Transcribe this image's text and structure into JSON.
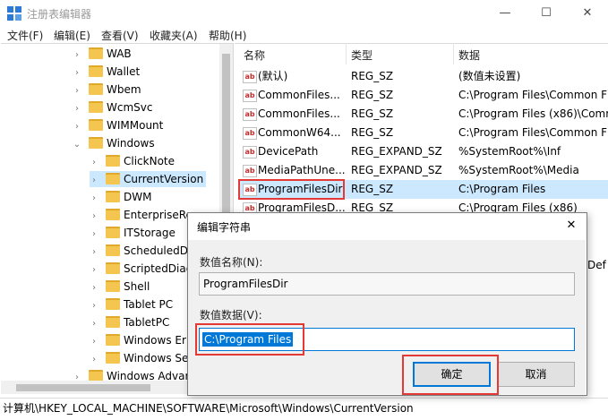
{
  "window": {
    "title": "注册表编辑器",
    "minimize": "—",
    "maximize": "☐",
    "close": "✕"
  },
  "menu": [
    "文件(F)",
    "编辑(E)",
    "查看(V)",
    "收藏夹(A)",
    "帮助(H)"
  ],
  "tree": {
    "items": [
      {
        "label": "WAB",
        "level": 1,
        "expanded": false
      },
      {
        "label": "Wallet",
        "level": 1,
        "expanded": false
      },
      {
        "label": "Wbem",
        "level": 1,
        "expanded": false
      },
      {
        "label": "WcmSvc",
        "level": 1,
        "expanded": false
      },
      {
        "label": "WIMMount",
        "level": 1,
        "expanded": false
      },
      {
        "label": "Windows",
        "level": 1,
        "expanded": true
      },
      {
        "label": "ClickNote",
        "level": 2,
        "expanded": false
      },
      {
        "label": "CurrentVersion",
        "level": 2,
        "expanded": false,
        "selected": true
      },
      {
        "label": "DWM",
        "level": 2,
        "expanded": false
      },
      {
        "label": "EnterpriseRe",
        "level": 2,
        "expanded": false
      },
      {
        "label": "ITStorage",
        "level": 2,
        "expanded": false
      },
      {
        "label": "ScheduledD",
        "level": 2,
        "expanded": false
      },
      {
        "label": "ScriptedDiag",
        "level": 2,
        "expanded": false
      },
      {
        "label": "Shell",
        "level": 2,
        "expanded": false
      },
      {
        "label": "Tablet PC",
        "level": 2,
        "expanded": false
      },
      {
        "label": "TabletPC",
        "level": 2,
        "expanded": false
      },
      {
        "label": "Windows Er",
        "level": 2,
        "expanded": false
      },
      {
        "label": "Windows Se",
        "level": 2,
        "expanded": false
      },
      {
        "label": "Windows Advar",
        "level": 1,
        "expanded": false
      }
    ]
  },
  "list": {
    "headers": [
      "名称",
      "类型",
      "数据"
    ],
    "rows": [
      {
        "name": "(默认)",
        "type": "REG_SZ",
        "data": "(数值未设置)"
      },
      {
        "name": "CommonFiles...",
        "type": "REG_SZ",
        "data": "C:\\Program Files\\Common F"
      },
      {
        "name": "CommonFiles...",
        "type": "REG_SZ",
        "data": "C:\\Program Files (x86)\\Comr"
      },
      {
        "name": "CommonW64...",
        "type": "REG_SZ",
        "data": "C:\\Program Files\\Common F"
      },
      {
        "name": "DevicePath",
        "type": "REG_EXPAND_SZ",
        "data": "%SystemRoot%\\Inf"
      },
      {
        "name": "MediaPathUne...",
        "type": "REG_EXPAND_SZ",
        "data": "%SystemRoot%\\Media"
      },
      {
        "name": "ProgramFilesDir",
        "type": "REG_SZ",
        "data": "C:\\Program Files",
        "selected": true
      },
      {
        "name": "ProgramFilesD...",
        "type": "REG_SZ",
        "data": "C:\\Program Files (x86)"
      }
    ],
    "partial_right": "Def"
  },
  "status": "计算机\\HKEY_LOCAL_MACHINE\\SOFTWARE\\Microsoft\\Windows\\CurrentVersion",
  "dialog": {
    "title": "编辑字符串",
    "close": "✕",
    "name_label": "数值名称(N):",
    "name_value": "ProgramFilesDir",
    "data_label": "数值数据(V):",
    "data_value": "C:\\Program Files",
    "ok": "确定",
    "cancel": "取消"
  },
  "colors": {
    "selection": "#cce8ff",
    "highlight_text": "#0078d7",
    "annotation_red": "#e53935"
  }
}
